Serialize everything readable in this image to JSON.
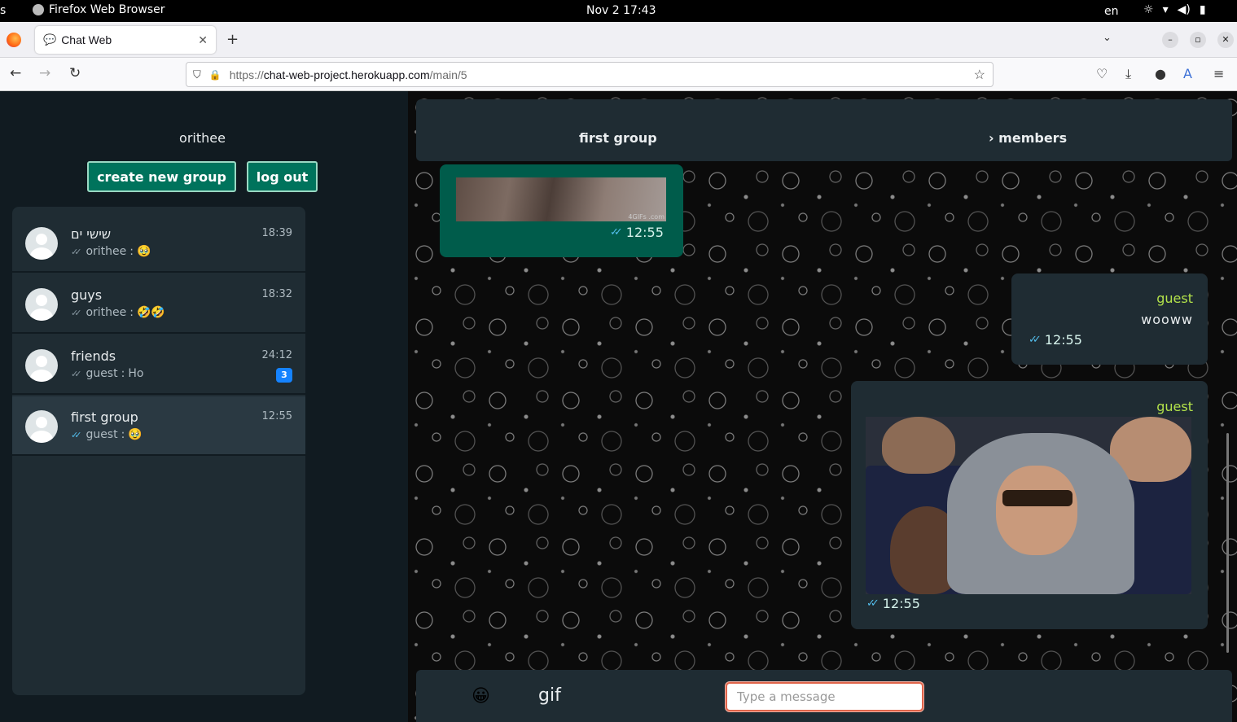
{
  "os": {
    "left_fragment": "s",
    "app_name": "Firefox Web Browser",
    "datetime": "Nov 2  17:43",
    "language": "en"
  },
  "browser": {
    "tab_title": "Chat Web",
    "url_prefix": "https://",
    "url_host": "chat-web-project.herokuapp.com",
    "url_path": "/main/5"
  },
  "sidebar": {
    "username": "orithee",
    "create_group_label": "create new group",
    "logout_label": "log out",
    "chats": [
      {
        "name": "שישי ים",
        "sender": "orithee",
        "preview": "🥹",
        "time": "18:39",
        "tick": "read-grey",
        "unread": ""
      },
      {
        "name": "guys",
        "sender": "orithee",
        "preview": "🤣🤣",
        "time": "18:32",
        "tick": "read-grey",
        "unread": ""
      },
      {
        "name": "friends",
        "sender": "guest",
        "preview": "Ho",
        "time": "24:12",
        "tick": "read-grey",
        "unread": "3"
      },
      {
        "name": "first group",
        "sender": "guest",
        "preview": "🥹",
        "time": "12:55",
        "tick": "read-blue",
        "unread": ""
      }
    ]
  },
  "chat": {
    "group_name": "first group",
    "members_label": "members",
    "messages": [
      {
        "direction": "out",
        "type": "gif",
        "gif_watermark": "4GIFs\n.com",
        "time": "12:55"
      },
      {
        "direction": "in",
        "type": "text",
        "sender": "guest",
        "text": "wooww",
        "time": "12:55"
      },
      {
        "direction": "in",
        "type": "gif",
        "sender": "guest",
        "time": "12:55"
      }
    ],
    "composer": {
      "emoji": "😀",
      "gif_label": "gif",
      "placeholder": "Type a message"
    }
  },
  "colors": {
    "accent_green": "#00735c",
    "sender_name": "#b3e24a",
    "read_tick": "#53bdeb",
    "badge": "#1583ff"
  }
}
